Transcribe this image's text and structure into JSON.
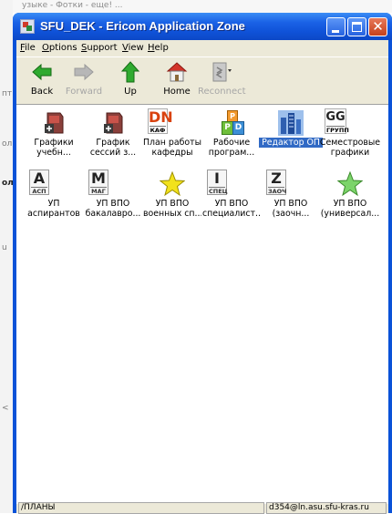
{
  "background": {
    "top_peek_text": "узыке - Фотки - еще! ...",
    "left_fragments": [
      "пт",
      "ол",
      "ол",
      "u",
      "<"
    ]
  },
  "window": {
    "title": "SFU_DEK - Ericom Application Zone",
    "controls": {
      "minimize": "minimize",
      "maximize": "maximize",
      "close": "✕"
    }
  },
  "menu": [
    "File",
    "Options",
    "Support",
    "View",
    "Help"
  ],
  "toolbar": {
    "buttons": [
      {
        "label": "Back",
        "icon": "back-arrow-icon",
        "enabled": true
      },
      {
        "label": "Forward",
        "icon": "forward-arrow-icon",
        "enabled": false
      },
      {
        "label": "Up",
        "icon": "up-arrow-icon",
        "enabled": true
      },
      {
        "label": "Home",
        "icon": "home-icon",
        "enabled": true
      },
      {
        "label": "Reconnect",
        "icon": "reconnect-icon",
        "enabled": false
      }
    ]
  },
  "apps": [
    {
      "label": "Графики\nучебн...",
      "icon": "red-document-icon"
    },
    {
      "label": "График\nсессий з...",
      "icon": "red-document-icon"
    },
    {
      "label": "План работы\nкафедры",
      "icon": "dn-kaf-icon",
      "icon_big": "DN",
      "icon_small": "КАФ"
    },
    {
      "label": "Рабочие\nпрограм...",
      "icon": "rpd-blocks-icon",
      "icon_text": [
        "Р",
        "Р",
        "D"
      ]
    },
    {
      "label": "Редактор ОП",
      "icon": "buildings-icon",
      "selected": true
    },
    {
      "label": "Семестровые\nграфики",
      "icon": "gg-grup-icon",
      "icon_big": "GG",
      "icon_small": "ГРУПП"
    },
    {
      "label": "УП\nаспирантов",
      "icon": "a-asp-icon",
      "icon_big": "A",
      "icon_small": "АСП"
    },
    {
      "label": "УП ВПО\nбакалавро...",
      "icon": "m-mag-icon",
      "icon_big": "M",
      "icon_small": "МАГ"
    },
    {
      "label": "УП ВПО\nвоенных сп...",
      "icon": "yellow-star-icon"
    },
    {
      "label": "УП ВПО\nспециалист...",
      "icon": "i-spec-icon",
      "icon_big": "I",
      "icon_small": "СПЕЦ"
    },
    {
      "label": "УП ВПО\n(заочн...",
      "icon": "z-zaoch-icon",
      "icon_big": "Z",
      "icon_small": "ЗАОЧ"
    },
    {
      "label": "УП ВПО\n(универсал...",
      "icon": "green-star-icon"
    }
  ],
  "status": {
    "left": "/ПЛАНЫ",
    "right": "d354@ln.asu.sfu-kras.ru"
  }
}
